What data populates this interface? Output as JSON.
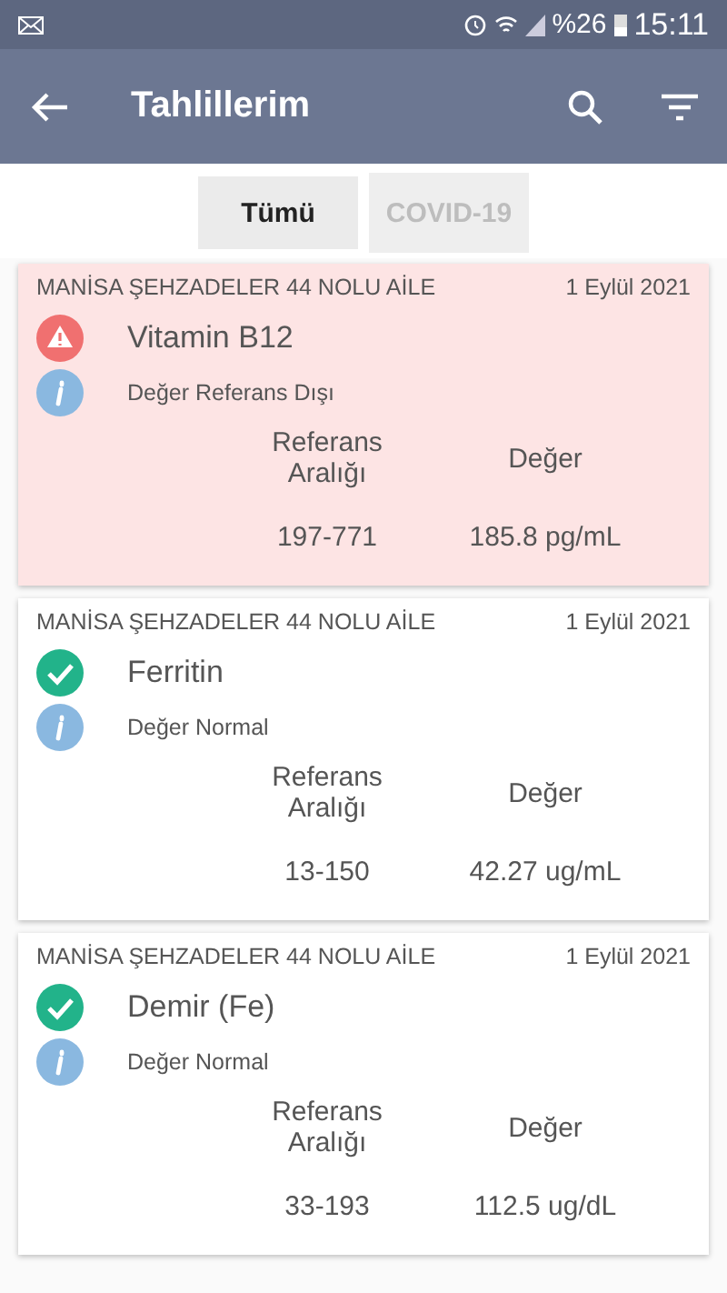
{
  "status_bar": {
    "battery": "%26",
    "time": "15:11"
  },
  "app_bar": {
    "title": "Tahlillerim"
  },
  "tabs": [
    {
      "label": "Tümü",
      "selected": true
    },
    {
      "label": "COVID-19",
      "selected": false
    }
  ],
  "results": [
    {
      "institution": "MANİSA ŞEHZADELER 44 NOLU AİLE",
      "date": "1 Eylül 2021",
      "kind": "warning",
      "test": "Vitamin B12",
      "note": "Değer Referans Dışı",
      "range_label": "Referans Aralığı",
      "value_label": "Değer",
      "range": "197-771",
      "value": "185.8 pg/mL"
    },
    {
      "institution": "MANİSA ŞEHZADELER 44 NOLU AİLE",
      "date": "1 Eylül 2021",
      "kind": "normal",
      "test": "Ferritin",
      "note": "Değer Normal",
      "range_label": "Referans Aralığı",
      "value_label": "Değer",
      "range": "13-150",
      "value": "42.27 ug/mL"
    },
    {
      "institution": "MANİSA ŞEHZADELER 44 NOLU AİLE",
      "date": "1 Eylül 2021",
      "kind": "normal",
      "test": "Demir (Fe)",
      "note": "Değer Normal",
      "range_label": "Referans Aralığı",
      "value_label": "Değer",
      "range": "33-193",
      "value": "112.5 ug/dL"
    }
  ]
}
